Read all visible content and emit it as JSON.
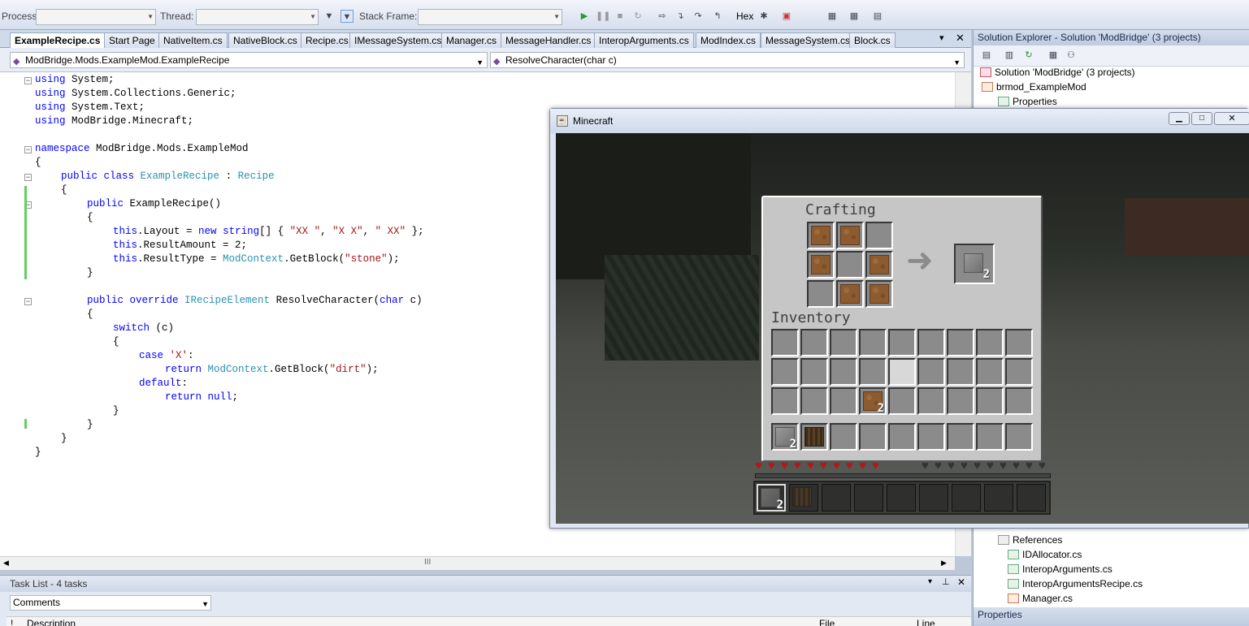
{
  "toolbar": {
    "process_label": "Process:",
    "thread_label": "Thread:",
    "stack_frame_label": "Stack Frame:",
    "hex_label": "Hex"
  },
  "tabs": [
    {
      "label": "ExampleRecipe.cs",
      "active": true
    },
    {
      "label": "Start Page"
    },
    {
      "label": "NativeItem.cs"
    },
    {
      "label": "NativeBlock.cs"
    },
    {
      "label": "Recipe.cs"
    },
    {
      "label": "IMessageSystem.cs"
    },
    {
      "label": "Manager.cs"
    },
    {
      "label": "MessageHandler.cs"
    },
    {
      "label": "InteropArguments.cs"
    },
    {
      "label": "ModIndex.cs"
    },
    {
      "label": "MessageSystem.cs"
    },
    {
      "label": "Block.cs"
    }
  ],
  "nav": {
    "type_combo": "ModBridge.Mods.ExampleMod.ExampleRecipe",
    "member_combo": "ResolveCharacter(char c)"
  },
  "code": {
    "l1": [
      "using",
      " System;"
    ],
    "l2": [
      "using",
      " System.Collections.Generic;"
    ],
    "l3": [
      "using",
      " System.Text;"
    ],
    "l4": [
      "using",
      " ModBridge.Minecraft;"
    ],
    "l6": [
      "namespace",
      " ModBridge.Mods.ExampleMod"
    ],
    "l7": "{",
    "l8": [
      "public class ",
      "ExampleRecipe",
      " : ",
      "Recipe"
    ],
    "l9": "{",
    "l10": [
      "public",
      " ExampleRecipe()"
    ],
    "l11": "{",
    "l12": [
      "this",
      ".Layout = ",
      "new",
      " ",
      "string",
      "[] { ",
      "\"XX \"",
      ", ",
      "\"X X\"",
      ", ",
      "\" XX\"",
      " };"
    ],
    "l13": [
      "this",
      ".ResultAmount = 2;"
    ],
    "l14": [
      "this",
      ".ResultType = ",
      "ModContext",
      ".GetBlock(",
      "\"stone\"",
      ");"
    ],
    "l15": "}",
    "l17": [
      "public override ",
      "IRecipeElement",
      " ResolveCharacter(",
      "char",
      " c)"
    ],
    "l18": "{",
    "l19": [
      "switch",
      " (c)"
    ],
    "l20": "{",
    "l21": [
      "case",
      " ",
      "'X'",
      ":"
    ],
    "l22": [
      "return",
      " ",
      "ModContext",
      ".GetBlock(",
      "\"dirt\"",
      ");"
    ],
    "l23": [
      "default",
      ":"
    ],
    "l24": [
      "return",
      " ",
      "null",
      ";"
    ],
    "l25": "}",
    "l26": "}",
    "l27": "}",
    "l28": "}"
  },
  "hscroll_grip": "III",
  "tasklist": {
    "title": "Task List - 4 tasks",
    "filter": "Comments",
    "col_excl": "!",
    "col_description": "Description",
    "col_file": "File",
    "col_line": "Line"
  },
  "solution_explorer": {
    "title": "Solution Explorer - Solution 'ModBridge' (3 projects)",
    "items": [
      "Solution 'ModBridge' (3 projects)",
      "brmod_ExampleMod",
      "Properties",
      "References",
      "IDAllocator.cs",
      "InteropArguments.cs",
      "InteropArgumentsRecipe.cs",
      "Manager.cs"
    ],
    "properties_panel": "Properties"
  },
  "minecraft": {
    "title": "Minecraft",
    "crafting_label": "Crafting",
    "inventory_label": "Inventory",
    "result_count": "2",
    "inv_dirt_count": "2",
    "hotbar_stone_count": "2",
    "hud_stone_count": "2",
    "health_hearts": 10,
    "armor_points": 10
  },
  "colors": {
    "keyword": "#0000ff",
    "type": "#2b91af",
    "string": "#a31515",
    "gui_bg": "#c6c6c6"
  }
}
